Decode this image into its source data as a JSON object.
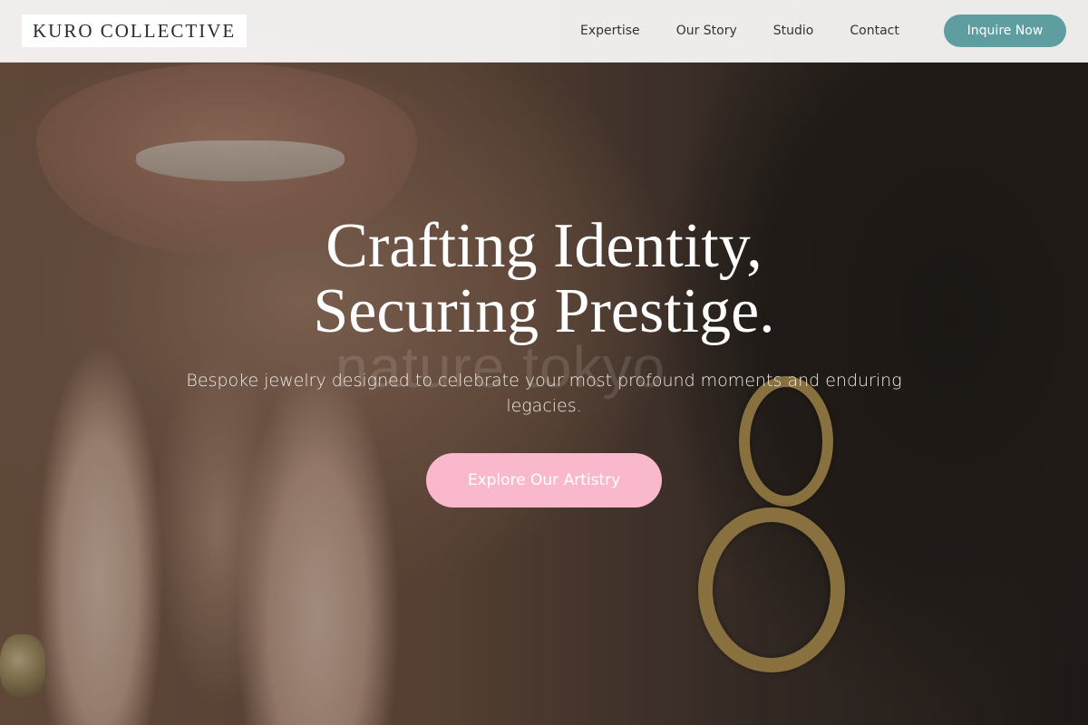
{
  "header": {
    "logo": "KURO COLLECTIVE",
    "nav": [
      {
        "label": "Expertise"
      },
      {
        "label": "Our Story"
      },
      {
        "label": "Studio"
      },
      {
        "label": "Contact"
      }
    ],
    "cta_label": "Inquire Now"
  },
  "hero": {
    "title_line1": "Crafting Identity,",
    "title_line2": "Securing Prestige.",
    "watermark": "nature tokyo",
    "subtitle": "Bespoke jewelry designed to celebrate your most profound moments and enduring legacies.",
    "button_label": "Explore Our Artistry"
  },
  "colors": {
    "accent_teal": "#5f9ea0",
    "accent_pink": "#f9b8cc",
    "header_bg": "#f8f7f6"
  }
}
